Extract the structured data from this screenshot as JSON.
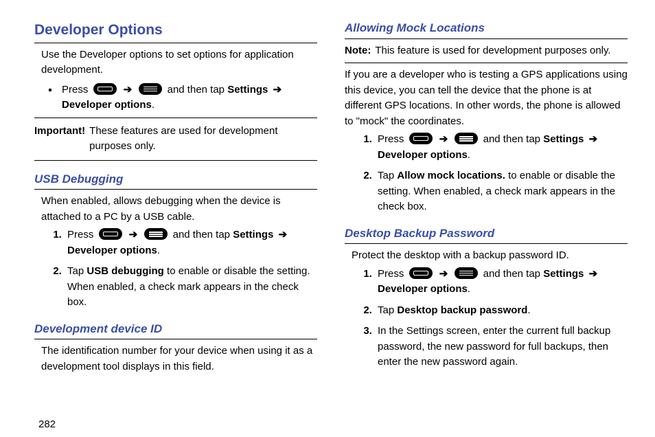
{
  "page_number": "282",
  "left": {
    "title": "Developer Options",
    "intro": "Use the Developer options to set options for application development.",
    "bullet": {
      "press": "Press",
      "tail": "and then tap",
      "settings": "Settings",
      "devopts": "Developer options"
    },
    "important_label": "Important!",
    "important_text": "These features are used for development purposes only.",
    "usb": {
      "title": "USB Debugging",
      "intro": "When enabled, allows debugging when the device is attached to a PC by a USB cable.",
      "step1": {
        "press": "Press",
        "tail": "and then tap",
        "settings": "Settings",
        "devopts": "Developer options"
      },
      "step2_a": "Tap",
      "step2_b": "USB debugging",
      "step2_c": "to enable or disable the setting. When enabled, a check mark appears in the check box."
    },
    "devid": {
      "title": "Development device ID",
      "intro": "The identification number for your device when using it as a development tool displays in this field."
    }
  },
  "right": {
    "mock": {
      "title": "Allowing Mock Locations",
      "note_label": "Note:",
      "note_text": "This feature is used for development purposes only.",
      "para": "If you are a developer who is testing a GPS applications using this device, you can tell the device that the phone is at different GPS locations. In other words, the phone is allowed to \"mock\" the coordinates.",
      "step1": {
        "press": "Press",
        "tail": "and then tap",
        "settings": "Settings",
        "devopts": "Developer options"
      },
      "step2_a": "Tap",
      "step2_b": "Allow mock locations.",
      "step2_c": "to enable or disable the setting. When enabled, a check mark appears in the check box."
    },
    "backup": {
      "title": "Desktop Backup Password",
      "intro": "Protect the desktop with a backup password ID.",
      "step1": {
        "press": "Press",
        "tail": "and then tap",
        "settings": "Settings",
        "devopts": "Developer options"
      },
      "step2_a": "Tap",
      "step2_b": "Desktop backup password",
      "step3": "In the Settings screen, enter the current full backup password, the new password for full backups, then enter the new password again."
    }
  }
}
